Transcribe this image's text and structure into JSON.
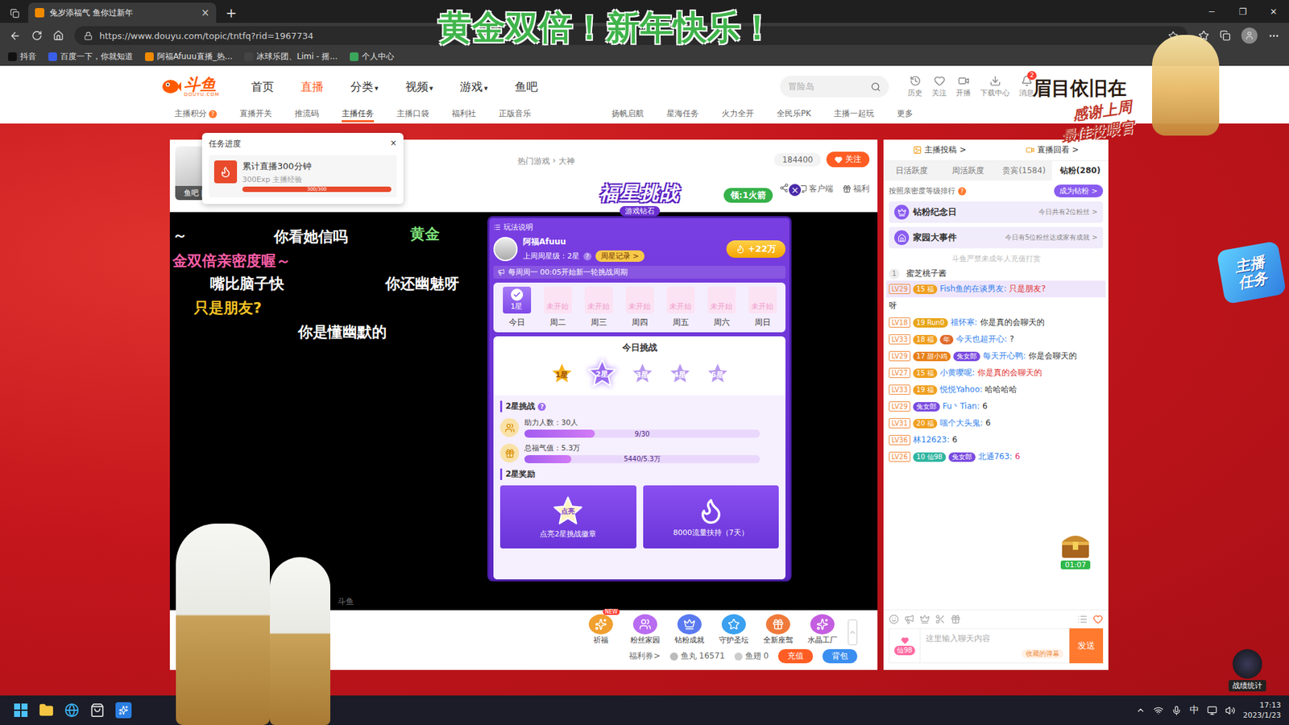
{
  "browser": {
    "tab_title": "兔岁添福气 鱼你过新年",
    "tab_close": "×",
    "new_tab": "+",
    "controls": [
      "─",
      "❐",
      "✕"
    ],
    "url": "https://www.douyu.com/topic/tntfq?rid=1967734",
    "bookmarks": [
      {
        "label": "抖音",
        "color": "#111111"
      },
      {
        "label": "百度一下，你就知道",
        "color": "#3a5ee8"
      },
      {
        "label": "阿福Afuuu直播_热...",
        "color": "#f08a00"
      },
      {
        "label": "冰球乐团、Limi - 摇...",
        "color": "#444444"
      },
      {
        "label": "个人中心",
        "color": "#3ba55c"
      }
    ]
  },
  "overlay": {
    "banner": "黄金双倍！新年快乐！",
    "corner_title": "眉目依旧在",
    "corner_sub": [
      "感谢上周",
      "最佳投喂官"
    ]
  },
  "header": {
    "logo": "斗鱼",
    "logo_sub": "DOUYU.COM",
    "nav": [
      {
        "label": "首页",
        "selected": false,
        "dropdown": false
      },
      {
        "label": "直播",
        "selected": true,
        "dropdown": false
      },
      {
        "label": "分类",
        "selected": false,
        "dropdown": true
      },
      {
        "label": "视频",
        "selected": false,
        "dropdown": true
      },
      {
        "label": "游戏",
        "selected": false,
        "dropdown": true
      },
      {
        "label": "鱼吧",
        "selected": false,
        "dropdown": false
      }
    ],
    "dropdown_mark": "▾",
    "search_placeholder": "冒险岛",
    "actions": [
      {
        "label": "历史"
      },
      {
        "label": "关注"
      },
      {
        "label": "开播"
      },
      {
        "label": "下载中心"
      },
      {
        "label": "消息",
        "badge": "2"
      }
    ]
  },
  "subnav": {
    "left": [
      {
        "label": "主播积分",
        "selected": false,
        "badge": "?"
      },
      {
        "label": "直播开关",
        "selected": false
      },
      {
        "label": "推流码",
        "selected": false
      },
      {
        "label": "主播任务",
        "selected": true
      },
      {
        "label": "主播口袋",
        "selected": false
      },
      {
        "label": "福利社",
        "selected": false
      },
      {
        "label": "正版音乐",
        "selected": false
      }
    ],
    "right": [
      {
        "label": "扬帆启航",
        "selected": false
      },
      {
        "label": "星海任务",
        "selected": false
      },
      {
        "label": "火力全开",
        "selected": false
      },
      {
        "label": "全民乐PK",
        "selected": false
      },
      {
        "label": "主播一起玩",
        "selected": false
      },
      {
        "label": "更多",
        "selected": false
      }
    ]
  },
  "player": {
    "avatar_links": "鱼吧 | 公告",
    "breadcrumb": [
      "热门游戏",
      "大神"
    ],
    "breadcrumb_sep": "›",
    "followers": "184400",
    "follow": "关注",
    "tools": [
      "客户端",
      "福利"
    ],
    "task": {
      "title": "任务进度",
      "close": "×",
      "name": "累计直播300分钟",
      "reward": "300Exp 主播经验",
      "reading": "300/300",
      "level": 1
    },
    "danmaku": [
      {
        "text": "～",
        "color": "#ffffff"
      },
      {
        "text": "你看她信吗",
        "color": "#ffffff"
      },
      {
        "text": "黄金",
        "color": "#7ee07a"
      },
      {
        "text": "金双倍亲密度喔～",
        "color": "#ff5fa8"
      },
      {
        "text": "嘴比脑子快",
        "color": "#ffffff"
      },
      {
        "text": "你还幽魅呀",
        "color": "#ffffff"
      },
      {
        "text": "只是朋友?",
        "color": "#f7c325"
      },
      {
        "text": "你是懂幽默的",
        "color": "#ffffff"
      }
    ],
    "watermark": "斗鱼",
    "gifts": [
      {
        "label": "祈福",
        "tag": "NEW",
        "color": "#f0a030"
      },
      {
        "label": "粉丝家园",
        "color": "#b86cf0"
      },
      {
        "label": "钻粉成就",
        "color": "#5a7af0"
      },
      {
        "label": "守护圣坛",
        "color": "#3aa0f0"
      },
      {
        "label": "全新座驾",
        "color": "#f07a3a"
      },
      {
        "label": "水晶工厂",
        "color": "#c45ee0"
      }
    ],
    "wallet": {
      "coupon": "福利券>",
      "fishball_label": "鱼丸",
      "fishball": "16571",
      "fin_label": "鱼翅",
      "fin": "0",
      "recharge": "充值",
      "bag": "背包"
    }
  },
  "challenge": {
    "title": "福星挑战",
    "subtitle": "游戏钻石",
    "reward_pill": "领:1火箭",
    "close": "×",
    "rules": "玩法说明",
    "user": "阿福Afuuu",
    "last_week": "上周周星级：2星",
    "help": "?",
    "record": "周星记录 >",
    "heat": "+22万",
    "notice": "每周周一 00:05开始新一轮挑战周期",
    "days": [
      {
        "status": "1星",
        "label": "今日",
        "done": true
      },
      {
        "status": "未开始",
        "label": "周二",
        "done": false
      },
      {
        "status": "未开始",
        "label": "周三",
        "done": false
      },
      {
        "status": "未开始",
        "label": "周四",
        "done": false
      },
      {
        "status": "未开始",
        "label": "周五",
        "done": false
      },
      {
        "status": "未开始",
        "label": "周六",
        "done": false
      },
      {
        "status": "未开始",
        "label": "周日",
        "done": false
      }
    ],
    "today_title": "今日挑战",
    "stars": [
      {
        "label": "1星",
        "achieved": true,
        "selected": false
      },
      {
        "label": "2星",
        "achieved": false,
        "selected": true
      },
      {
        "label": "3星",
        "achieved": false,
        "selected": false
      },
      {
        "label": "4星",
        "achieved": false,
        "selected": false
      },
      {
        "label": "5星",
        "achieved": false,
        "selected": false
      }
    ],
    "goal_title": "2星挑战",
    "goals": [
      {
        "label": "助力人数：30人",
        "reading": "9/30",
        "level": 0.3
      },
      {
        "label": "总福气值：5.3万",
        "reading": "5440/5.3万",
        "level": 0.2
      }
    ],
    "reward_title": "2星奖励",
    "rewards": [
      {
        "badge": "点亮",
        "caption": "点亮2星挑战徽章"
      },
      {
        "caption": "8000流量扶持（7天）"
      }
    ]
  },
  "chat": {
    "top_tabs": [
      "主播投稿 >",
      "直播回看 >"
    ],
    "rank_tabs": [
      {
        "label": "日活跃度",
        "selected": false
      },
      {
        "label": "周活跃度",
        "selected": false
      },
      {
        "label": "贵宾(1584)",
        "selected": false
      },
      {
        "label": "钻粉(280)",
        "selected": true
      }
    ],
    "rank_note": "按照亲密度等级排行",
    "rank_help": "?",
    "become": "成为钻粉 >",
    "cards": [
      {
        "title": "钻粉纪念日",
        "text": "今日共有2位粉丝 >"
      },
      {
        "title": "家园大事件",
        "text": "今日有5位粉丝达成家有成就 >"
      }
    ],
    "warning": "斗鱼严禁未成年人充值打赏",
    "top_rank": {
      "rank": "1",
      "name": "蜜芝桃子酱"
    },
    "messages": [
      {
        "kind": "message",
        "level": "LV29",
        "badges": [
          {
            "text": "15 福",
            "color": "#f0a020"
          }
        ],
        "name": "Fish鱼的在谈男友:",
        "text": "只是朋友?",
        "text_color": "#e0302e",
        "highlight": true
      },
      {
        "kind": "fragment",
        "text": "呀",
        "text_color": "#333333",
        "highlight": false
      },
      {
        "kind": "message",
        "level": "LV18",
        "badges": [
          {
            "text": "19 Run0",
            "color": "#e8a61a"
          }
        ],
        "name": "祖怀寒:",
        "text": "你是真的会聊天的",
        "text_color": "#333333",
        "highlight": false
      },
      {
        "kind": "message",
        "level": "LV33",
        "badges": [
          {
            "text": "18 福",
            "color": "#f0a020"
          },
          {
            "text": "年",
            "color": "#e06a2a"
          }
        ],
        "name": "今天也超开心:",
        "text": "?",
        "text_color": "#333333",
        "highlight": false
      },
      {
        "kind": "message",
        "level": "LV29",
        "badges": [
          {
            "text": "17 甜小鸡",
            "color": "#e8801a"
          },
          {
            "text": "兔女郎",
            "color": "#7a4ae0"
          }
        ],
        "name": "每天开心鸭:",
        "text": "你是会聊天的",
        "text_color": "#333333",
        "highlight": false
      },
      {
        "kind": "message",
        "level": "LV27",
        "badges": [
          {
            "text": "15 福",
            "color": "#f0a020"
          }
        ],
        "name": "小黄嘤呢:",
        "text": "你是真的会聊天的",
        "text_color": "#e0302e",
        "highlight": false
      },
      {
        "kind": "message",
        "level": "LV33",
        "badges": [
          {
            "text": "19 福",
            "color": "#f0a020"
          }
        ],
        "name": "悦悦Yahoo:",
        "text": "哈哈哈哈",
        "text_color": "#333333",
        "highlight": false
      },
      {
        "kind": "message",
        "level": "LV29",
        "badges": [
          {
            "text": "兔女郎",
            "color": "#7a4ae0"
          }
        ],
        "name": "Fu丶Tian:",
        "text": "6",
        "text_color": "#333333",
        "highlight": false
      },
      {
        "kind": "message",
        "level": "LV31",
        "badges": [
          {
            "text": "20 福",
            "color": "#f0a020"
          }
        ],
        "name": "嗤个大头鬼:",
        "text": "6",
        "text_color": "#333333",
        "highlight": false
      },
      {
        "kind": "message",
        "level": "LV36",
        "badges": [],
        "name": "林12623:",
        "text": "6",
        "text_color": "#333333",
        "highlight": false
      },
      {
        "kind": "message",
        "level": "LV26",
        "badges": [
          {
            "text": "10 仙98",
            "color": "#2fb5a0"
          },
          {
            "text": "兔女郎",
            "color": "#7a4ae0"
          }
        ],
        "name": "北通763:",
        "text": "6",
        "text_color": "#e0306e",
        "highlight": false
      }
    ],
    "chest_timer": "01:07",
    "input_placeholder": "这里输入聊天内容",
    "saved": "收藏的弹幕",
    "send": "发送",
    "badge": "仙98"
  },
  "stickers": {
    "task": "主播任务",
    "stats": "战绩统计"
  },
  "taskbar": {
    "ime": "中",
    "time": "17:13",
    "date": "2023/1/23"
  }
}
